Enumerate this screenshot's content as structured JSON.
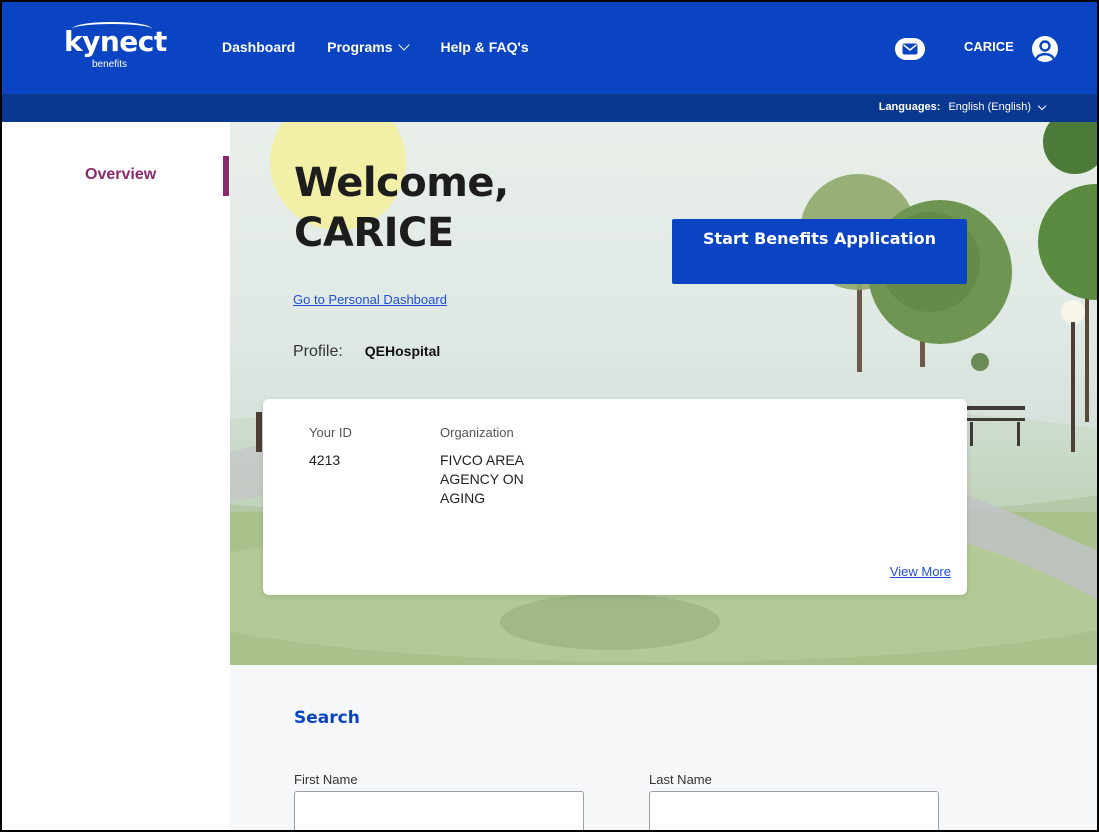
{
  "header": {
    "logo_word": "kynect",
    "logo_sub": "benefits",
    "nav": [
      {
        "label": "Dashboard"
      },
      {
        "label": "Programs",
        "has_dropdown": true
      },
      {
        "label": "Help & FAQ's"
      }
    ],
    "user_name": "CARICE",
    "icons": {
      "mail": "envelope-icon",
      "avatar": "user-avatar-icon"
    },
    "languages_label": "Languages:",
    "language_value": "English (English)"
  },
  "sidebar": {
    "items": [
      {
        "label": "Overview",
        "active": true
      }
    ]
  },
  "hero": {
    "welcome_line1": "Welcome,",
    "welcome_line2": "CARICE",
    "dashboard_link": "Go to Personal Dashboard",
    "profile_label": "Profile:",
    "profile_value": "QEHospital",
    "start_button": "Start Benefits Application"
  },
  "card": {
    "id_label": "Your ID",
    "id_value": "4213",
    "org_label": "Organization",
    "org_value": "FIVCO AREA AGENCY ON AGING",
    "view_more": "View More"
  },
  "search": {
    "title": "Search",
    "first_name_label": "First Name",
    "first_name_value": "",
    "last_name_label": "Last Name",
    "last_name_value": ""
  },
  "colors": {
    "brand_blue": "#0b44c2",
    "lang_bar": "#0a3891",
    "accent_purple": "#8a2a6e",
    "link_blue": "#1f4fd6"
  }
}
